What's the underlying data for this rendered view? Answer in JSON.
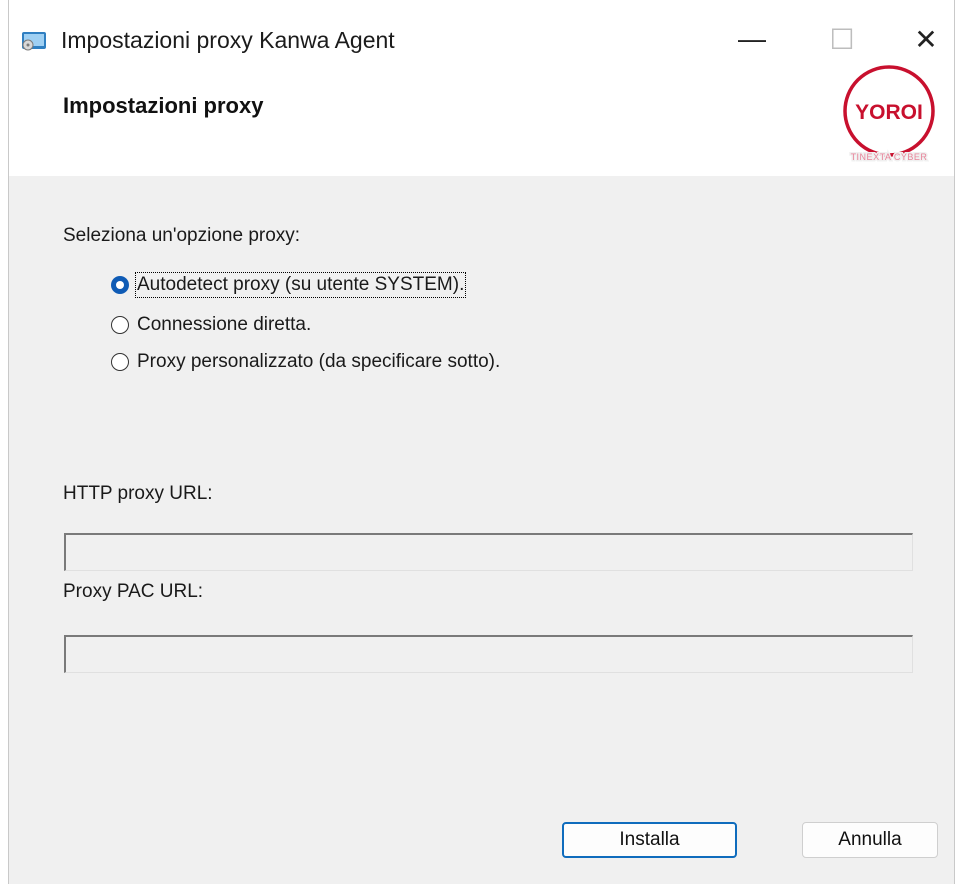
{
  "window": {
    "title": "Impostazioni proxy Kanwa Agent",
    "controls": {
      "minimize": "—",
      "maximize": "☐",
      "close": "✕"
    }
  },
  "header": {
    "title": "Impostazioni proxy",
    "logo": {
      "brand": "YOROI",
      "tagline": "TINEXTA CYBER",
      "color": "#c8102e"
    }
  },
  "proxy_options": {
    "prompt": "Seleziona un'opzione proxy:",
    "options": [
      {
        "label": "Autodetect proxy (su utente SYSTEM).",
        "selected": true
      },
      {
        "label": "Connessione diretta.",
        "selected": false
      },
      {
        "label": "Proxy personalizzato (da specificare sotto).",
        "selected": false
      }
    ]
  },
  "fields": {
    "http_proxy_label": "HTTP proxy URL:",
    "http_proxy_value": "",
    "pac_label": "Proxy PAC URL:",
    "pac_value": ""
  },
  "buttons": {
    "install": "Installa",
    "cancel": "Annulla"
  },
  "colors": {
    "accent": "#0f5bb5",
    "default_button_border": "#0f6cbd",
    "dialog_background": "#f0f0f0"
  }
}
